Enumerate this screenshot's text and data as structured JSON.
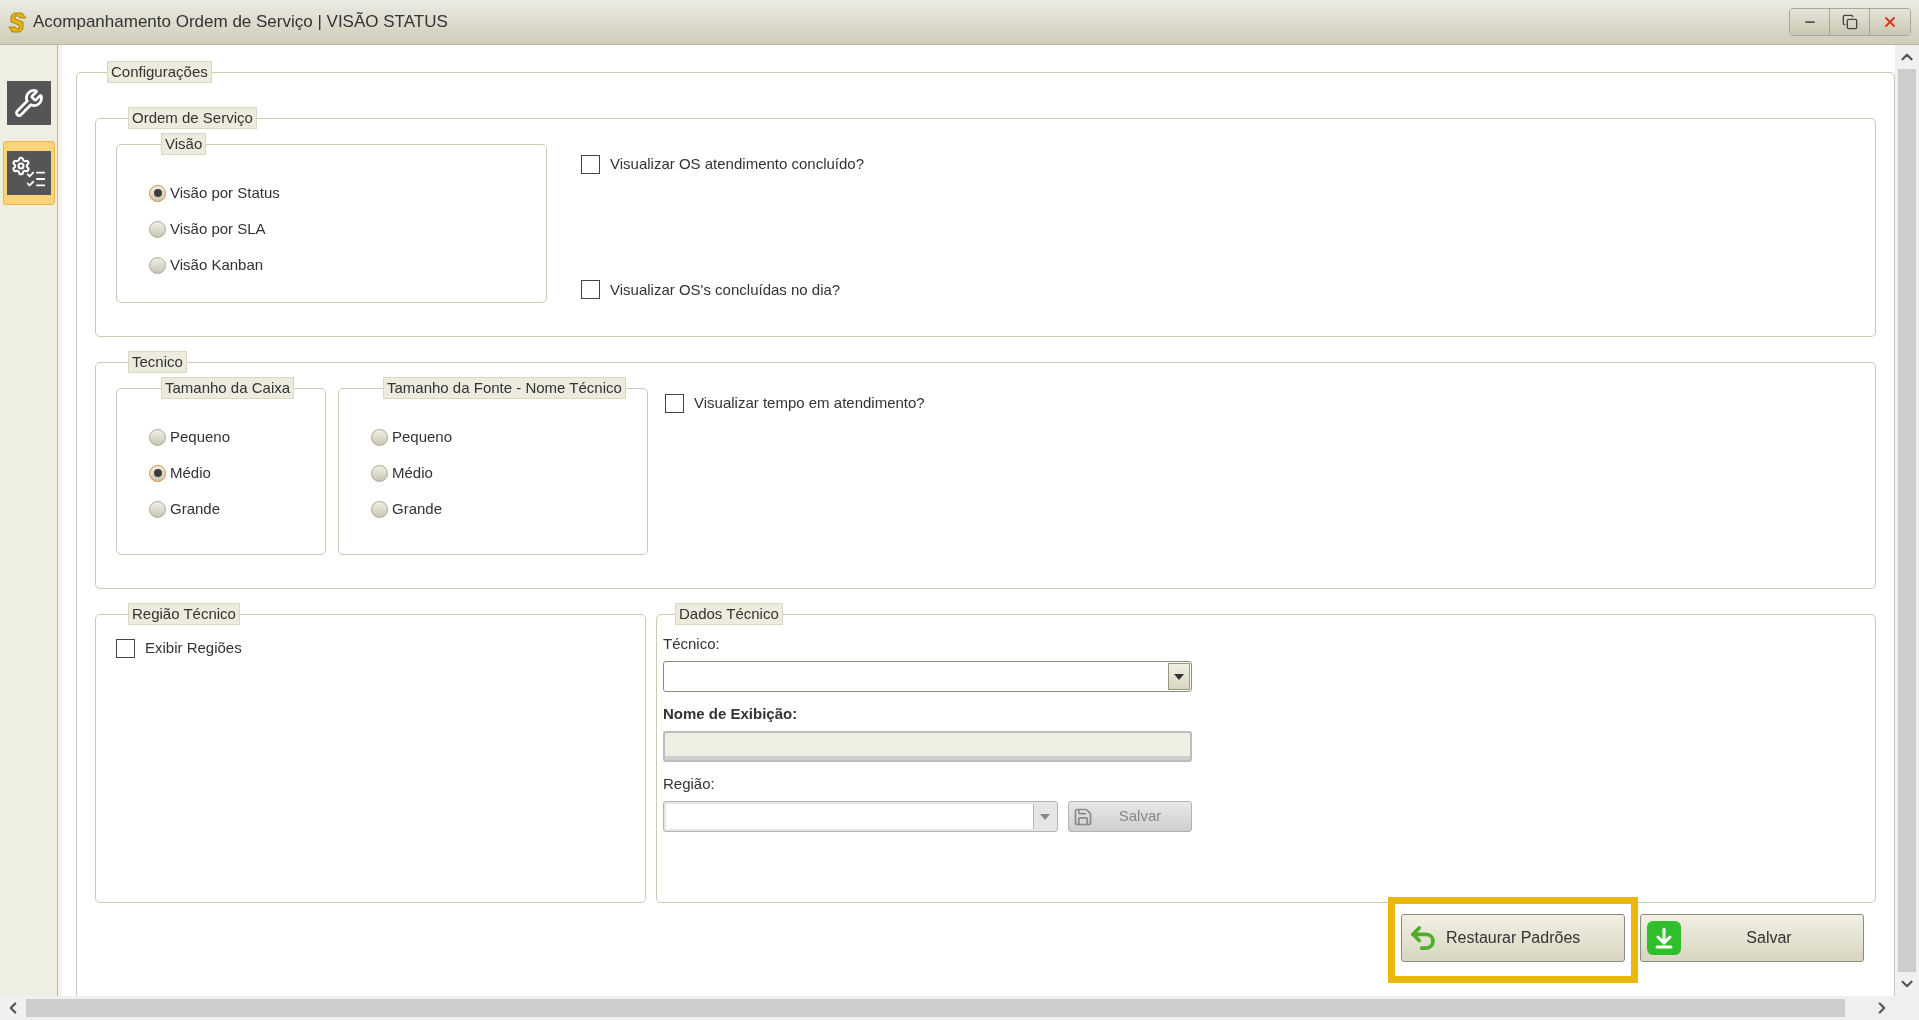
{
  "window": {
    "title": "Acompanhamento Ordem de Serviço | VISÃO STATUS"
  },
  "sidebar": {
    "items": [
      {
        "kind": "tools",
        "selected": false
      },
      {
        "kind": "settings",
        "selected": true
      }
    ]
  },
  "configuracoes": {
    "legend": "Configurações",
    "ordem_de_servico": {
      "legend": "Ordem de Serviço",
      "visao": {
        "legend": "Visão",
        "options": [
          {
            "label": "Visão por Status",
            "selected": true
          },
          {
            "label": "Visão por SLA",
            "selected": false
          },
          {
            "label": "Visão Kanban",
            "selected": false
          }
        ]
      },
      "checkboxes": [
        {
          "label": "Visualizar OS atendimento concluído?",
          "checked": false
        },
        {
          "label": "Visualizar OS's concluídas no dia?",
          "checked": false
        }
      ]
    },
    "tecnico": {
      "legend": "Tecnico",
      "groups": [
        {
          "legend": "Tamanho da Caixa",
          "options": [
            {
              "label": "Pequeno",
              "selected": false
            },
            {
              "label": "Médio",
              "selected": true
            },
            {
              "label": "Grande",
              "selected": false
            }
          ]
        },
        {
          "legend": "Tamanho da Fonte - Nome Técnico",
          "options": [
            {
              "label": "Pequeno",
              "selected": false
            },
            {
              "label": "Médio",
              "selected": false
            },
            {
              "label": "Grande",
              "selected": false
            }
          ]
        }
      ],
      "checkboxes": [
        {
          "label": "Visualizar tempo em atendimento?",
          "checked": false
        }
      ]
    },
    "regiao_tecnico": {
      "legend": "Região Técnico",
      "checkboxes": [
        {
          "label": "Exibir Regiões",
          "checked": false
        }
      ]
    },
    "dados_tecnico": {
      "legend": "Dados Técnico",
      "fields": [
        {
          "label": "Técnico:",
          "kind": "select",
          "bold": false
        },
        {
          "label": "Nome de Exibição:",
          "kind": "text",
          "bold": true,
          "disabled": true
        },
        {
          "label": "Região:",
          "kind": "select-with-button",
          "bold": false
        }
      ],
      "field_button": {
        "label": "Salvar",
        "disabled": true
      }
    }
  },
  "buttons": [
    {
      "label": "Restaurar Padrões",
      "kind": "restore",
      "highlighted": true
    },
    {
      "label": "Salvar",
      "kind": "save",
      "highlighted": false
    }
  ]
}
